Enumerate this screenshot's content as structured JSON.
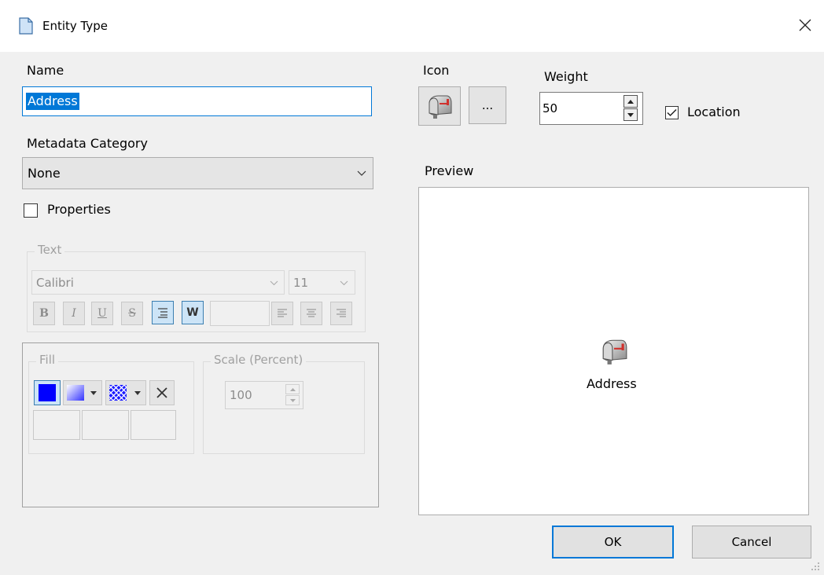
{
  "window": {
    "title": "Entity Type",
    "close_icon": "close-icon",
    "document_icon": "document-icon"
  },
  "name": {
    "label": "Name",
    "value": "Address"
  },
  "metadata": {
    "label": "Metadata Category",
    "selected": "None"
  },
  "properties": {
    "label": "Properties",
    "checked": false
  },
  "icon": {
    "label": "Icon",
    "browse_label": "...",
    "image": "mailbox-icon"
  },
  "weight": {
    "label": "Weight",
    "value": "50"
  },
  "location": {
    "label": "Location",
    "checked": true
  },
  "preview": {
    "label": "Preview",
    "entity_label": "Address"
  },
  "text_group": {
    "legend": "Text",
    "font": "Calibri",
    "size": "11",
    "buttons": [
      "B",
      "I",
      "U",
      "S"
    ]
  },
  "fill_group": {
    "legend": "Fill",
    "color": "#0000ff"
  },
  "scale_group": {
    "legend": "Scale (Percent)",
    "value": "100"
  },
  "buttons": {
    "ok": "OK",
    "cancel": "Cancel"
  }
}
